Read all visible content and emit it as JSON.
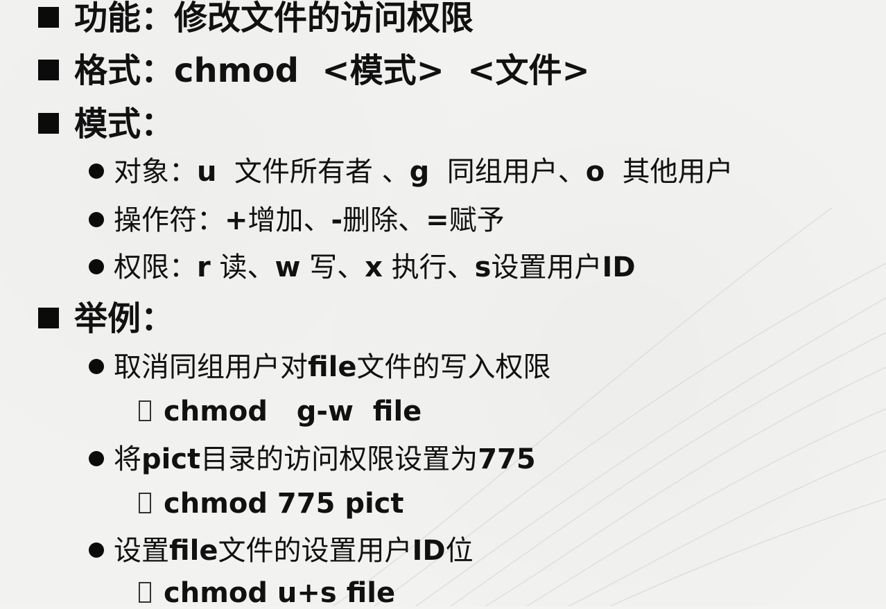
{
  "bullets": {
    "function_label": "功能：",
    "function_text": "修改文件的访问权限",
    "format_label": "格式：",
    "format_text": "chmod  <模式>  <文件>",
    "mode_label": "模式：",
    "examples_label": "举例："
  },
  "modes": {
    "objects_label": "对象：",
    "objects_u": "u",
    "objects_u_desc": "  文件所有者 、",
    "objects_g": "g",
    "objects_g_desc": "  同组用户、",
    "objects_o": "o",
    "objects_o_desc": "  其他用户",
    "operators_label": "操作符：",
    "operators_plus": "+",
    "operators_plus_desc": "增加、",
    "operators_minus": "-",
    "operators_minus_desc": "删除、",
    "operators_equal": "=",
    "operators_equal_desc": "赋予",
    "perms_label": "权限：",
    "perms_r": "r",
    "perms_r_desc": " 读、",
    "perms_w": "w",
    "perms_w_desc": " 写、",
    "perms_x": "x",
    "perms_x_desc": " 执行、",
    "perms_s": "s",
    "perms_s_desc": "设置用户",
    "perms_id": "ID"
  },
  "examples": [
    {
      "desc_pre": "取消同组用户对",
      "desc_bold": "file",
      "desc_post": "文件的写入权限",
      "command": "chmod   g-w  file"
    },
    {
      "desc_pre": "将",
      "desc_bold": "pict",
      "desc_post": "目录的访问权限设置为",
      "desc_bold2": "775",
      "command": "chmod 775 pict"
    },
    {
      "desc_pre": "设置",
      "desc_bold": "file",
      "desc_post": "文件的设置用户",
      "desc_bold2": "ID",
      "desc_post2": "位",
      "command": "chmod u+s file"
    }
  ],
  "icons": {
    "square_bullet": "black-square-icon",
    "round_bullet": "black-circle-icon",
    "command_marker": "placeholder-box-icon"
  }
}
